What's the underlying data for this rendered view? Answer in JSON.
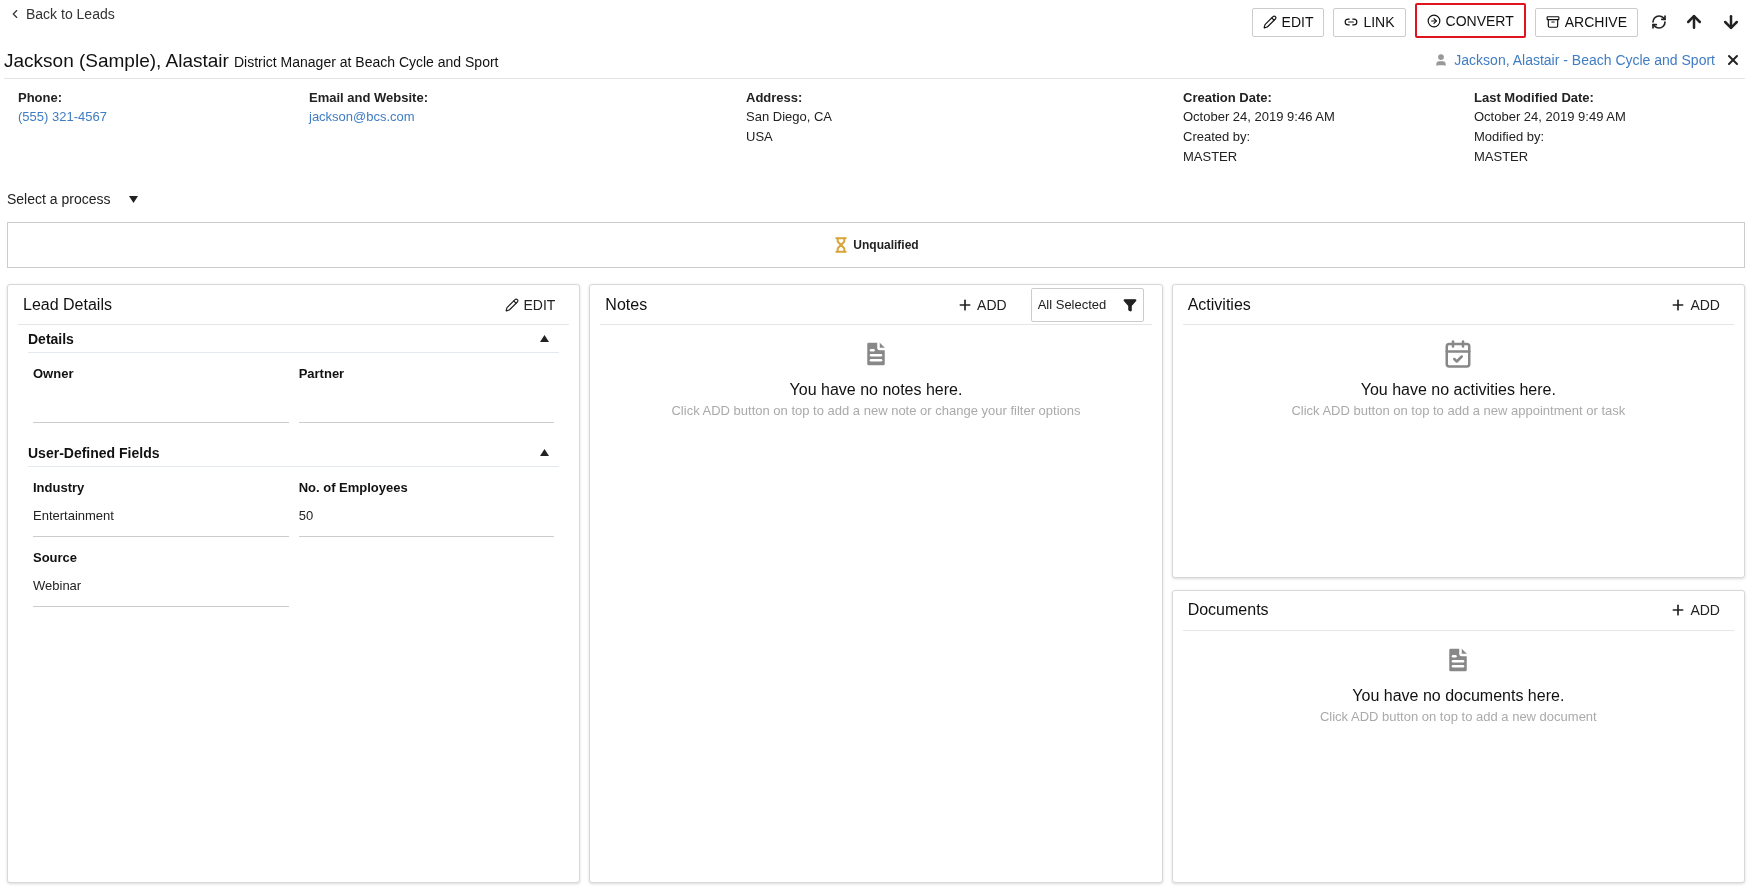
{
  "back_link": "Back to Leads",
  "toolbar": {
    "buttons": [
      {
        "kind": "edit",
        "label": "EDIT",
        "highlighted": false
      },
      {
        "kind": "link",
        "label": "LINK",
        "highlighted": false
      },
      {
        "kind": "convert",
        "label": "CONVERT",
        "highlighted": true
      },
      {
        "kind": "archive",
        "label": "ARCHIVE",
        "highlighted": false
      }
    ]
  },
  "header": {
    "name": "Jackson (Sample), Alastair",
    "subtitle": "District Manager at Beach Cycle and Sport",
    "contact_link": "Jackson, Alastair - Beach Cycle and Sport"
  },
  "info": [
    {
      "label": "Phone:",
      "lines": [
        {
          "kind": "link",
          "text": "(555) 321-4567"
        }
      ]
    },
    {
      "label": "Email and Website:",
      "lines": [
        {
          "kind": "link",
          "text": "jackson@bcs.com"
        }
      ]
    },
    {
      "label": "Address:",
      "lines": [
        {
          "kind": "text",
          "text": "San Diego, CA"
        },
        {
          "kind": "text",
          "text": "USA"
        }
      ]
    },
    {
      "label": "Creation Date:",
      "lines": [
        {
          "kind": "text",
          "text": "October 24, 2019 9:46 AM"
        },
        {
          "kind": "text",
          "text": "Created by:"
        },
        {
          "kind": "text",
          "text": "MASTER"
        }
      ]
    },
    {
      "label": "Last Modified Date:",
      "lines": [
        {
          "kind": "text",
          "text": "October 24, 2019 9:49 AM"
        },
        {
          "kind": "text",
          "text": "Modified by:"
        },
        {
          "kind": "text",
          "text": "MASTER"
        }
      ]
    }
  ],
  "process_select": "Select a process",
  "status": "Unqualified",
  "lead_details": {
    "title": "Lead Details",
    "edit_label": "EDIT",
    "sections": [
      {
        "title": "Details",
        "expanded": true,
        "fields": [
          {
            "label": "Owner"
          },
          {
            "label": "Partner"
          }
        ]
      },
      {
        "title": "User-Defined Fields",
        "expanded": true,
        "fields": [
          {
            "label": "Industry",
            "value": "Entertainment"
          },
          {
            "label": "No. of Employees",
            "value": "50"
          },
          {
            "label": "Source",
            "value": "Webinar"
          }
        ]
      }
    ]
  },
  "notes": {
    "title": "Notes",
    "add_label": "ADD",
    "filter": "All Selected",
    "empty_title": "You have no notes here.",
    "empty_hint": "Click ADD button on top to add a new note or change your filter options"
  },
  "activities": {
    "title": "Activities",
    "add_label": "ADD",
    "empty_title": "You have no activities here.",
    "empty_hint": "Click ADD button on top to add a new appointment or task"
  },
  "documents": {
    "title": "Documents",
    "add_label": "ADD",
    "empty_title": "You have no documents here.",
    "empty_hint": "Click ADD button on top to add a new document"
  }
}
